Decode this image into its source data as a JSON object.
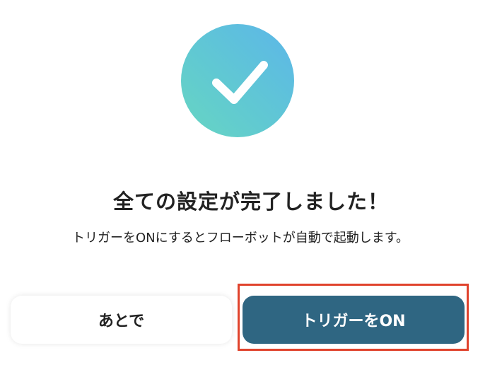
{
  "dialog": {
    "title": "全ての設定が完了しました！",
    "message": "トリガーをONにするとフローボットが自動で起動します。",
    "later_button_label": "あとで",
    "trigger_on_button_label": "トリガーをON"
  },
  "icons": {
    "success": "check-icon"
  },
  "colors": {
    "primary_button": "#2f6682",
    "highlight_border": "#e0432d",
    "check_gradient_start": "#67d6c2",
    "check_gradient_end": "#5cb6e9"
  }
}
